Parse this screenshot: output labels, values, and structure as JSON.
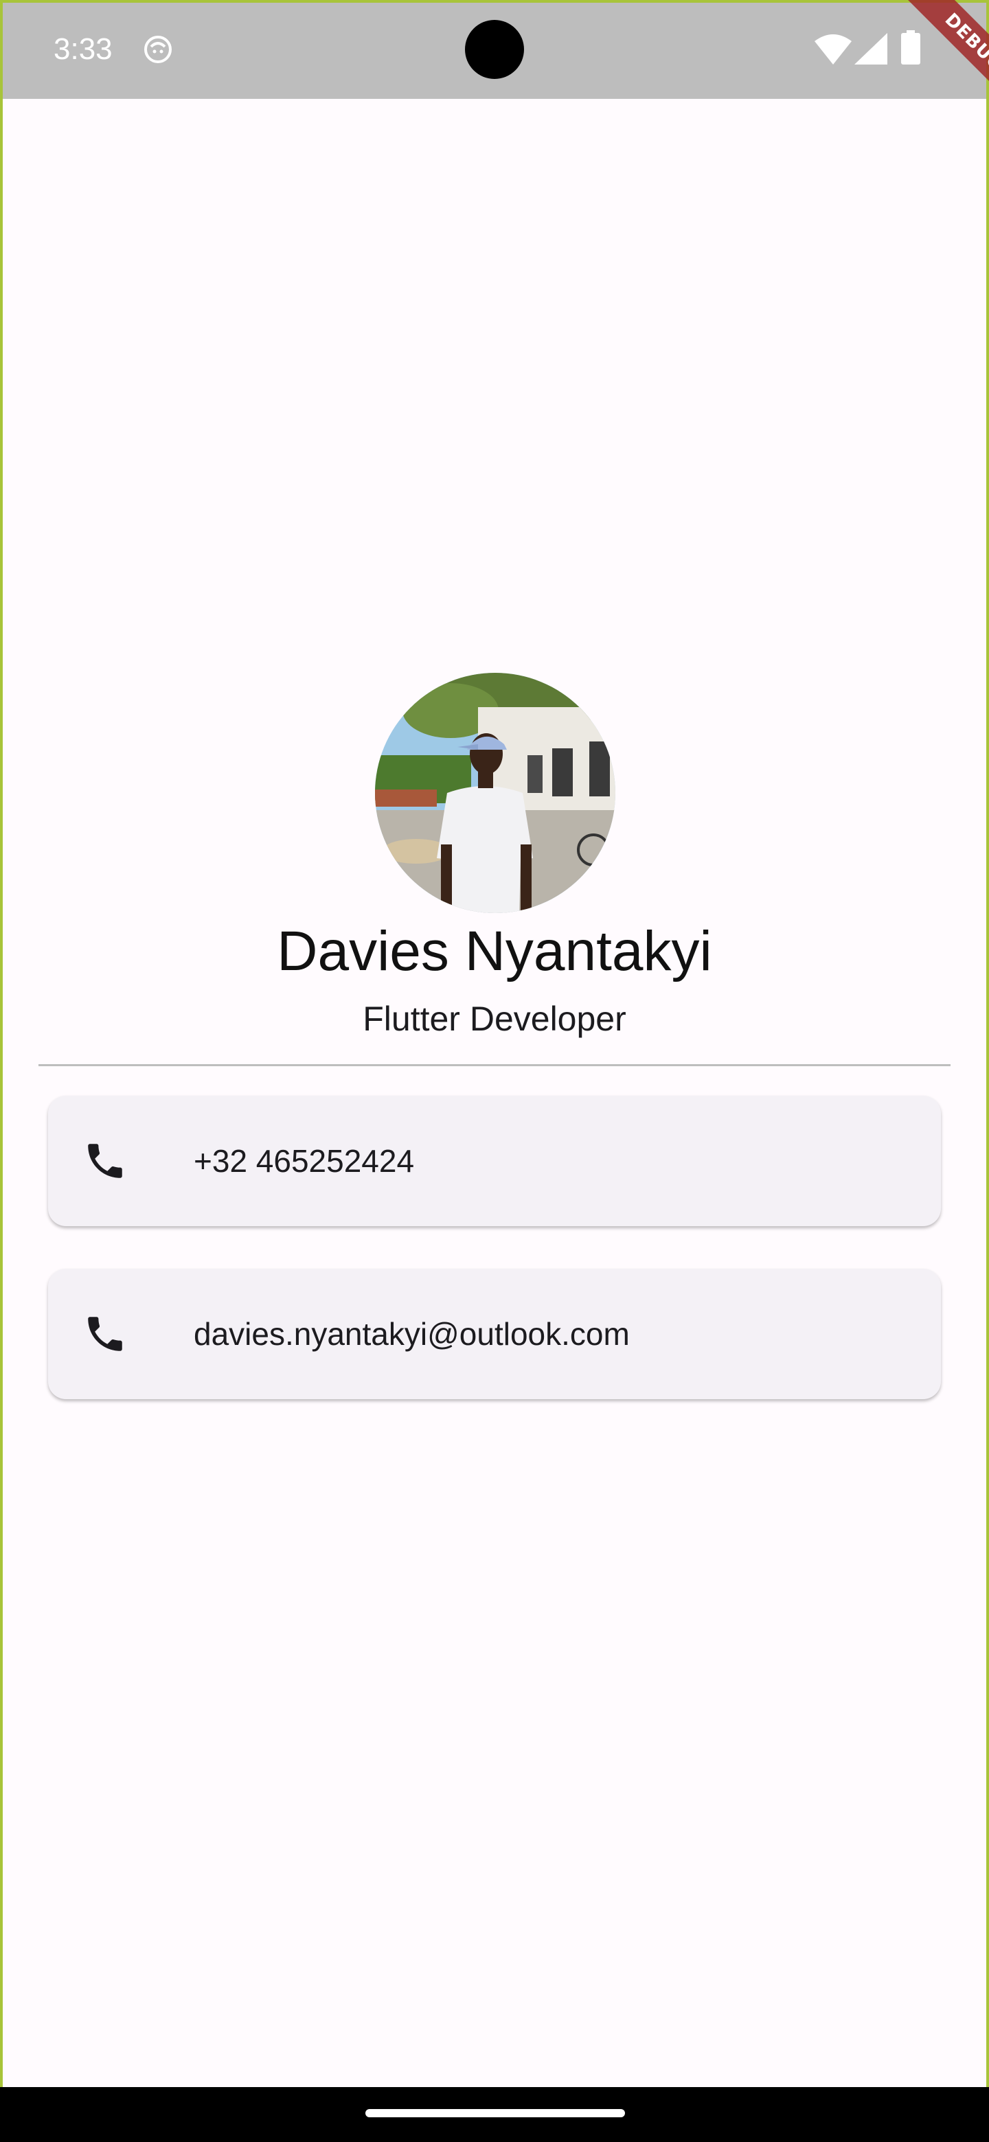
{
  "status_bar": {
    "time": "3:33",
    "icons": [
      "app-notification-icon",
      "wifi-icon",
      "signal-icon",
      "battery-icon"
    ]
  },
  "debug_banner": {
    "label": "DEBUG"
  },
  "profile": {
    "name": "Davies Nyantakyi",
    "title": "Flutter Developer"
  },
  "contacts": [
    {
      "icon": "phone-icon",
      "value": "+32 465252424"
    },
    {
      "icon": "phone-icon",
      "value": "davies.nyantakyi@outlook.com"
    }
  ],
  "colors": {
    "background": "#fffbfe",
    "status_bar": "#bdbdbd",
    "card": "#f4f1f6",
    "divider": "#bdbdbd",
    "frame_border": "#a8c43a",
    "debug_ribbon": "#a02828"
  }
}
